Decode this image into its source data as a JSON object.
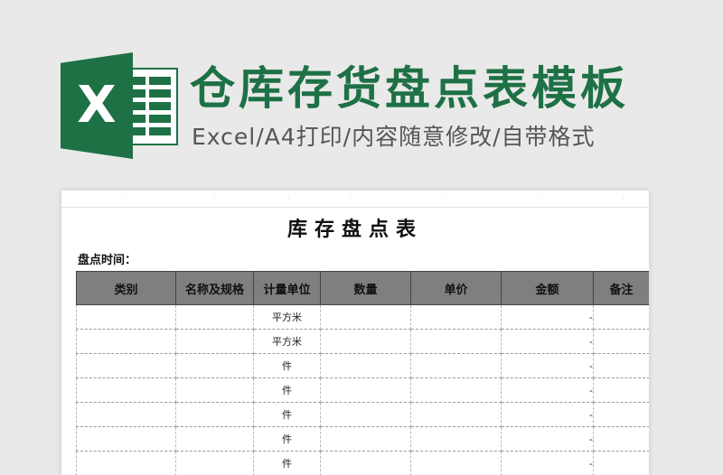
{
  "header": {
    "title": "仓库存货盘点表模板",
    "subtitle": "Excel/A4打印/内容随意修改/自带格式",
    "logo_letter": "X",
    "accent_color": "#1e7145"
  },
  "sheet": {
    "title": "库存盘点表",
    "date_label": "盘点时间：",
    "columns": [
      "类别",
      "名称及规格",
      "计量单位",
      "数量",
      "单价",
      "金额",
      "备注"
    ],
    "rows": [
      {
        "unit": "平方米",
        "amount": "-"
      },
      {
        "unit": "平方米",
        "amount": "-"
      },
      {
        "unit": "件",
        "amount": "-"
      },
      {
        "unit": "件",
        "amount": "-"
      },
      {
        "unit": "件",
        "amount": "-"
      },
      {
        "unit": "件",
        "amount": "-"
      },
      {
        "unit": "件",
        "amount": "-"
      }
    ]
  }
}
